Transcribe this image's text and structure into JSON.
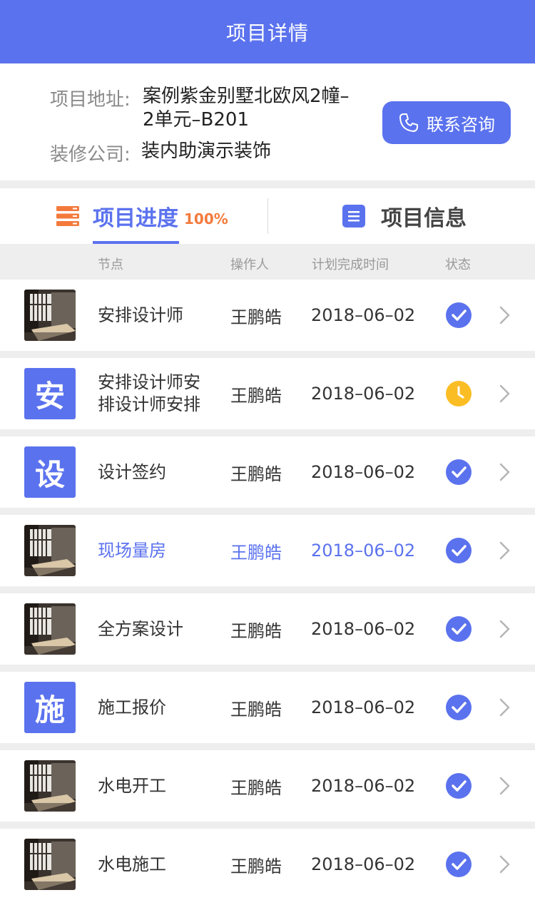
{
  "header": {
    "title": "项目详情"
  },
  "info": {
    "address_label": "项目地址:",
    "address_value": "案例紫金别墅北欧风2幢–2单元–B201",
    "company_label": "装修公司:",
    "company_value": "装内助演示装饰",
    "contact_button": "联系咨询"
  },
  "tabs": {
    "progress_label": "项目进度",
    "progress_percent": "100%",
    "info_label": "项目信息"
  },
  "columns": {
    "node": "节点",
    "operator": "操作人",
    "planned_time": "计划完成时间",
    "status": "状态"
  },
  "colors": {
    "accent": "#5b72ee",
    "pending": "#fbbd24",
    "orange": "#f47a3c"
  },
  "rows": [
    {
      "thumb_type": "photo",
      "thumb_text": "",
      "name": "安排设计师",
      "operator": "王鹏皓",
      "date": "2018–06–02",
      "status": "done"
    },
    {
      "thumb_type": "letter",
      "thumb_text": "安",
      "name": "安排设计师安排设计师安排",
      "operator": "王鹏皓",
      "date": "2018–06–02",
      "status": "pending"
    },
    {
      "thumb_type": "letter",
      "thumb_text": "设",
      "name": "设计签约",
      "operator": "王鹏皓",
      "date": "2018–06–02",
      "status": "done"
    },
    {
      "thumb_type": "photo",
      "thumb_text": "",
      "name": "现场量房",
      "operator": "王鹏皓",
      "date": "2018–06–02",
      "status": "done",
      "active": true
    },
    {
      "thumb_type": "photo",
      "thumb_text": "",
      "name": "全方案设计",
      "operator": "王鹏皓",
      "date": "2018–06–02",
      "status": "done"
    },
    {
      "thumb_type": "letter",
      "thumb_text": "施",
      "name": "施工报价",
      "operator": "王鹏皓",
      "date": "2018–06–02",
      "status": "done"
    },
    {
      "thumb_type": "photo",
      "thumb_text": "",
      "name": "水电开工",
      "operator": "王鹏皓",
      "date": "2018–06–02",
      "status": "done"
    },
    {
      "thumb_type": "photo",
      "thumb_text": "",
      "name": "水电施工",
      "operator": "王鹏皓",
      "date": "2018–06–02",
      "status": "done"
    }
  ]
}
